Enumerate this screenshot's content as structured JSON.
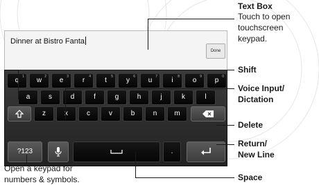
{
  "text_box": {
    "value": "Dinner at Bistro Fanta",
    "done_label": "Done"
  },
  "keyboard": {
    "row1": [
      {
        "label": "q",
        "hint": "1"
      },
      {
        "label": "w",
        "hint": "2"
      },
      {
        "label": "e",
        "hint": "3"
      },
      {
        "label": "r",
        "hint": "4"
      },
      {
        "label": "t",
        "hint": "5"
      },
      {
        "label": "y",
        "hint": "6"
      },
      {
        "label": "u",
        "hint": "7"
      },
      {
        "label": "i",
        "hint": "8"
      },
      {
        "label": "o",
        "hint": "9"
      },
      {
        "label": "p",
        "hint": "0"
      }
    ],
    "row2": [
      "a",
      "s",
      "d",
      "f",
      "g",
      "h",
      "j",
      "k",
      "l"
    ],
    "row3": [
      "z",
      "x",
      "c",
      "v",
      "b",
      "n",
      "m"
    ],
    "symbols_label": "?123",
    "period_label": "."
  },
  "callouts": {
    "text_box_title": "Text Box",
    "text_box_desc_1": "Touch to open",
    "text_box_desc_2": "touchscreen",
    "text_box_desc_3": "keypad.",
    "shift": "Shift",
    "voice_1": "Voice Input/",
    "voice_2": "Dictation",
    "delete": "Delete",
    "return_1": "Return/",
    "return_2": "New Line",
    "space": "Space",
    "symbols_desc_1": "Open a keypad for",
    "symbols_desc_2": "numbers & symbols."
  }
}
